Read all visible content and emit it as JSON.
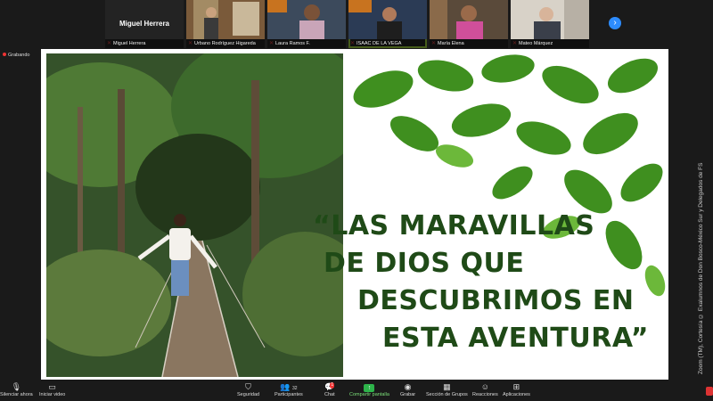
{
  "participants": [
    {
      "name": "Miguel Herrera",
      "video": false,
      "muted": true
    },
    {
      "name": "Urbano Rodríguez Higareda",
      "video": true,
      "muted": true
    },
    {
      "name": "Laura Ramos F.",
      "video": true,
      "muted": true
    },
    {
      "name": "ISAAC DE LA VEGA",
      "video": true,
      "muted": true,
      "active": true
    },
    {
      "name": "María Elena",
      "video": true,
      "muted": true
    },
    {
      "name": "Mateo Márquez",
      "video": true,
      "muted": true
    }
  ],
  "active_speaker_label": "Miguel Herrera",
  "recording_label": "Grabando",
  "slide": {
    "title_lines": [
      "“LAS MARAVILLAS",
      "DE DIOS QUE",
      "DESCUBRIMOS EN",
      "ESTA AVENTURA”"
    ]
  },
  "credit": "Zoom (TM), Cortesía © Exalumnos de Don Bosco-México Sur y Delegados de FS",
  "toolbar": {
    "unmute": "Silenciar ahora",
    "video": "Iniciar video",
    "security": "Seguridad",
    "participants": "Participantes",
    "participants_count": "32",
    "chat": "Chat",
    "chat_badge": "1",
    "share": "Compartir pantalla",
    "record": "Grabar",
    "breakout": "Sección de Grupos",
    "reactions": "Reacciones",
    "apps": "Aplicaciones"
  },
  "colors": {
    "title": "#1f4a17",
    "share_green": "#2db34a",
    "accent_blue": "#2d8cff",
    "mute_red": "#e04040"
  }
}
